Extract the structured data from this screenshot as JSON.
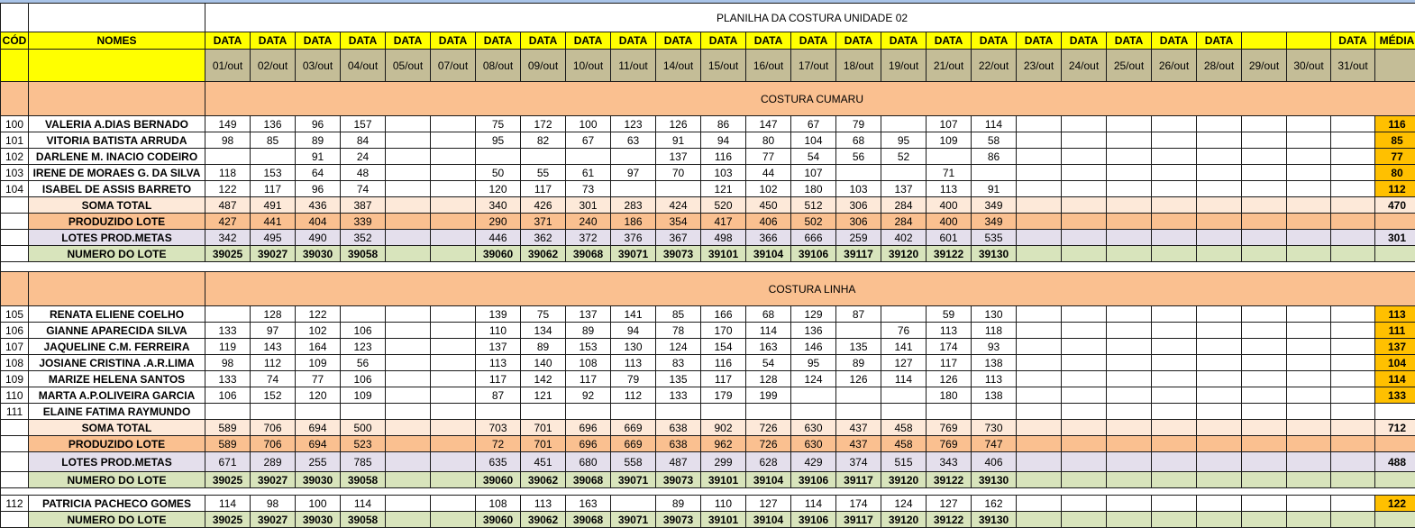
{
  "title": "PLANILHA DA COSTURA UNIDADE 02",
  "header": {
    "cod": "CÓD",
    "nomes": "NOMES",
    "data_label": "DATA",
    "media": "MÉDIA",
    "columns": [
      {
        "label": "DATA",
        "date": "01/out"
      },
      {
        "label": "DATA",
        "date": "02/out"
      },
      {
        "label": "DATA",
        "date": "03/out"
      },
      {
        "label": "DATA",
        "date": "04/out"
      },
      {
        "label": "DATA",
        "date": "05/out"
      },
      {
        "label": "DATA",
        "date": "07/out"
      },
      {
        "label": "DATA",
        "date": "08/out"
      },
      {
        "label": "DATA",
        "date": "09/out"
      },
      {
        "label": "DATA",
        "date": "10/out"
      },
      {
        "label": "DATA",
        "date": "11/out"
      },
      {
        "label": "DATA",
        "date": "14/out"
      },
      {
        "label": "DATA",
        "date": "15/out"
      },
      {
        "label": "DATA",
        "date": "16/out"
      },
      {
        "label": "DATA",
        "date": "17/out"
      },
      {
        "label": "DATA",
        "date": "18/out"
      },
      {
        "label": "DATA",
        "date": "19/out"
      },
      {
        "label": "DATA",
        "date": "21/out"
      },
      {
        "label": "DATA",
        "date": "22/out"
      },
      {
        "label": "DATA",
        "date": "23/out"
      },
      {
        "label": "DATA",
        "date": "24/out"
      },
      {
        "label": "DATA",
        "date": "25/out"
      },
      {
        "label": "DATA",
        "date": "26/out"
      },
      {
        "label": "DATA",
        "date": "28/out"
      },
      {
        "label": "",
        "date": "29/out"
      },
      {
        "label": "",
        "date": "30/out"
      },
      {
        "label": "DATA",
        "date": "31/out"
      }
    ]
  },
  "sections": [
    {
      "name": "COSTURA CUMARU",
      "workers": [
        {
          "cod": "100",
          "name": "VALERIA A.DIAS BERNADO",
          "values": [
            "149",
            "136",
            "96",
            "157",
            "",
            "",
            "75",
            "172",
            "100",
            "123",
            "126",
            "86",
            "147",
            "67",
            "79",
            "",
            "107",
            "114",
            "",
            "",
            "",
            "",
            "",
            "",
            "",
            ""
          ],
          "media": "116"
        },
        {
          "cod": "101",
          "name": "VITORIA BATISTA ARRUDA",
          "values": [
            "98",
            "85",
            "89",
            "84",
            "",
            "",
            "95",
            "82",
            "67",
            "63",
            "91",
            "94",
            "80",
            "104",
            "68",
            "95",
            "109",
            "58",
            "",
            "",
            "",
            "",
            "",
            "",
            "",
            ""
          ],
          "media": "85"
        },
        {
          "cod": "102",
          "name": "DARLENE M. INACIO CODEIRO",
          "values": [
            "",
            "",
            "91",
            "24",
            "",
            "",
            "",
            "",
            "",
            "",
            "137",
            "116",
            "77",
            "54",
            "56",
            "52",
            "",
            "86",
            "",
            "",
            "",
            "",
            "",
            "",
            "",
            ""
          ],
          "media": "77"
        },
        {
          "cod": "103",
          "name": "IRENE DE MORAES G. DA SILVA",
          "values": [
            "118",
            "153",
            "64",
            "48",
            "",
            "",
            "50",
            "55",
            "61",
            "97",
            "70",
            "103",
            "44",
            "107",
            "",
            "",
            "71",
            "",
            "",
            "",
            "",
            "",
            "",
            "",
            "",
            ""
          ],
          "media": "80"
        },
        {
          "cod": "104",
          "name": "ISABEL DE ASSIS BARRETO",
          "values": [
            "122",
            "117",
            "96",
            "74",
            "",
            "",
            "120",
            "117",
            "73",
            "",
            "",
            "121",
            "102",
            "180",
            "103",
            "137",
            "113",
            "91",
            "",
            "",
            "",
            "",
            "",
            "",
            "",
            ""
          ],
          "media": "112"
        }
      ],
      "summary": [
        {
          "label": "SOMA TOTAL",
          "style": "peach",
          "values": [
            "487",
            "491",
            "436",
            "387",
            "",
            "",
            "340",
            "426",
            "301",
            "283",
            "424",
            "520",
            "450",
            "512",
            "306",
            "284",
            "400",
            "349",
            "",
            "",
            "",
            "",
            "",
            "",
            "",
            ""
          ],
          "media": "470"
        },
        {
          "label": "PRODUZIDO LOTE",
          "style": "orange",
          "values": [
            "427",
            "441",
            "404",
            "339",
            "",
            "",
            "290",
            "371",
            "240",
            "186",
            "354",
            "417",
            "406",
            "502",
            "306",
            "284",
            "400",
            "349",
            "",
            "",
            "",
            "",
            "",
            "",
            "",
            ""
          ],
          "media": ""
        },
        {
          "label": "LOTES PROD.METAS",
          "style": "lav",
          "values": [
            "342",
            "495",
            "490",
            "352",
            "",
            "",
            "446",
            "362",
            "372",
            "376",
            "367",
            "498",
            "366",
            "666",
            "259",
            "402",
            "601",
            "535",
            "",
            "",
            "",
            "",
            "",
            "",
            "",
            ""
          ],
          "media": "301"
        },
        {
          "label": "NUMERO DO LOTE",
          "style": "green",
          "values": [
            "39025",
            "39027",
            "39030",
            "39058",
            "",
            "",
            "39060",
            "39062",
            "39068",
            "39071",
            "39073",
            "39101",
            "39104",
            "39106",
            "39117",
            "39120",
            "39122",
            "39130",
            "",
            "",
            "",
            "",
            "",
            "",
            "",
            ""
          ],
          "media": ""
        }
      ]
    },
    {
      "name": "COSTURA LINHA",
      "workers": [
        {
          "cod": "105",
          "name": "RENATA ELIENE COELHO",
          "values": [
            "",
            "128",
            "122",
            "",
            "",
            "",
            "139",
            "75",
            "137",
            "141",
            "85",
            "166",
            "68",
            "129",
            "87",
            "",
            "59",
            "130",
            "",
            "",
            "",
            "",
            "",
            "",
            "",
            ""
          ],
          "media": "113"
        },
        {
          "cod": "106",
          "name": "GIANNE APARECIDA SILVA",
          "values": [
            "133",
            "97",
            "102",
            "106",
            "",
            "",
            "110",
            "134",
            "89",
            "94",
            "78",
            "170",
            "114",
            "136",
            "",
            "76",
            "113",
            "118",
            "",
            "",
            "",
            "",
            "",
            "",
            "",
            ""
          ],
          "media": "111"
        },
        {
          "cod": "107",
          "name": "JAQUELINE C.M. FERREIRA",
          "values": [
            "119",
            "143",
            "164",
            "123",
            "",
            "",
            "137",
            "89",
            "153",
            "130",
            "124",
            "154",
            "163",
            "146",
            "135",
            "141",
            "174",
            "93",
            "",
            "",
            "",
            "",
            "",
            "",
            "",
            ""
          ],
          "media": "137"
        },
        {
          "cod": "108",
          "name": "JOSIANE CRISTINA .A.R.LIMA",
          "values": [
            "98",
            "112",
            "109",
            "56",
            "",
            "",
            "113",
            "140",
            "108",
            "113",
            "83",
            "116",
            "54",
            "95",
            "89",
            "127",
            "117",
            "138",
            "",
            "",
            "",
            "",
            "",
            "",
            "",
            ""
          ],
          "media": "104"
        },
        {
          "cod": "109",
          "name": "MARIZE HELENA SANTOS",
          "values": [
            "133",
            "74",
            "77",
            "106",
            "",
            "",
            "117",
            "142",
            "117",
            "79",
            "135",
            "117",
            "128",
            "124",
            "126",
            "114",
            "126",
            "113",
            "",
            "",
            "",
            "",
            "",
            "",
            "",
            ""
          ],
          "media": "114"
        },
        {
          "cod": "110",
          "name": "MARTA A.P.OLIVEIRA GARCIA",
          "values": [
            "106",
            "152",
            "120",
            "109",
            "",
            "",
            "87",
            "121",
            "92",
            "112",
            "133",
            "179",
            "199",
            "",
            "",
            "",
            "180",
            "138",
            "",
            "",
            "",
            "",
            "",
            "",
            "",
            ""
          ],
          "media": "133"
        },
        {
          "cod": "111",
          "name": "ELAINE FATIMA RAYMUNDO",
          "values": [
            "",
            "",
            "",
            "",
            "",
            "",
            "",
            "",
            "",
            "",
            "",
            "",
            "",
            "",
            "",
            "",
            "",
            "",
            "",
            "",
            "",
            "",
            "",
            "",
            "",
            ""
          ],
          "media": ""
        }
      ],
      "summary": [
        {
          "label": "SOMA TOTAL",
          "style": "peach",
          "values": [
            "589",
            "706",
            "694",
            "500",
            "",
            "",
            "703",
            "701",
            "696",
            "669",
            "638",
            "902",
            "726",
            "630",
            "437",
            "458",
            "769",
            "730",
            "",
            "",
            "",
            "",
            "",
            "",
            "",
            ""
          ],
          "media": "712"
        },
        {
          "label": "PRODUZIDO LOTE",
          "style": "orange",
          "values": [
            "589",
            "706",
            "694",
            "523",
            "",
            "",
            "72",
            "701",
            "696",
            "669",
            "638",
            "962",
            "726",
            "630",
            "437",
            "458",
            "769",
            "747",
            "",
            "",
            "",
            "",
            "",
            "",
            "",
            ""
          ],
          "media": ""
        },
        {
          "label": "LOTES PROD.METAS",
          "style": "lav",
          "values": [
            "671",
            "289",
            "255",
            "785",
            "",
            "",
            "635",
            "451",
            "680",
            "558",
            "487",
            "299",
            "628",
            "429",
            "374",
            "515",
            "343",
            "406",
            "",
            "",
            "",
            "",
            "",
            "",
            "",
            ""
          ],
          "media": "488"
        },
        {
          "label": "NUMERO DO LOTE",
          "style": "green",
          "values": [
            "39025",
            "39027",
            "39030",
            "39058",
            "",
            "",
            "39060",
            "39062",
            "39068",
            "39071",
            "39073",
            "39101",
            "39104",
            "39106",
            "39117",
            "39120",
            "39122",
            "39130",
            "",
            "",
            "",
            "",
            "",
            "",
            "",
            ""
          ],
          "media": ""
        }
      ]
    }
  ],
  "extra": {
    "worker": {
      "cod": "112",
      "name": "PATRICIA PACHECO GOMES",
      "values": [
        "114",
        "98",
        "100",
        "114",
        "",
        "",
        "108",
        "113",
        "163",
        "",
        "89",
        "110",
        "127",
        "114",
        "174",
        "124",
        "127",
        "162",
        "",
        "",
        "",
        "",
        "",
        "",
        "",
        ""
      ],
      "media": "122"
    },
    "lote": {
      "label": "NUMERO DO LOTE",
      "values": [
        "39025",
        "39027",
        "39030",
        "39058",
        "",
        "",
        "39060",
        "39062",
        "39068",
        "39071",
        "39073",
        "39101",
        "39104",
        "39106",
        "39117",
        "39120",
        "39122",
        "39130",
        "",
        "",
        "",
        "",
        "",
        "",
        "",
        ""
      ],
      "media": ""
    }
  }
}
